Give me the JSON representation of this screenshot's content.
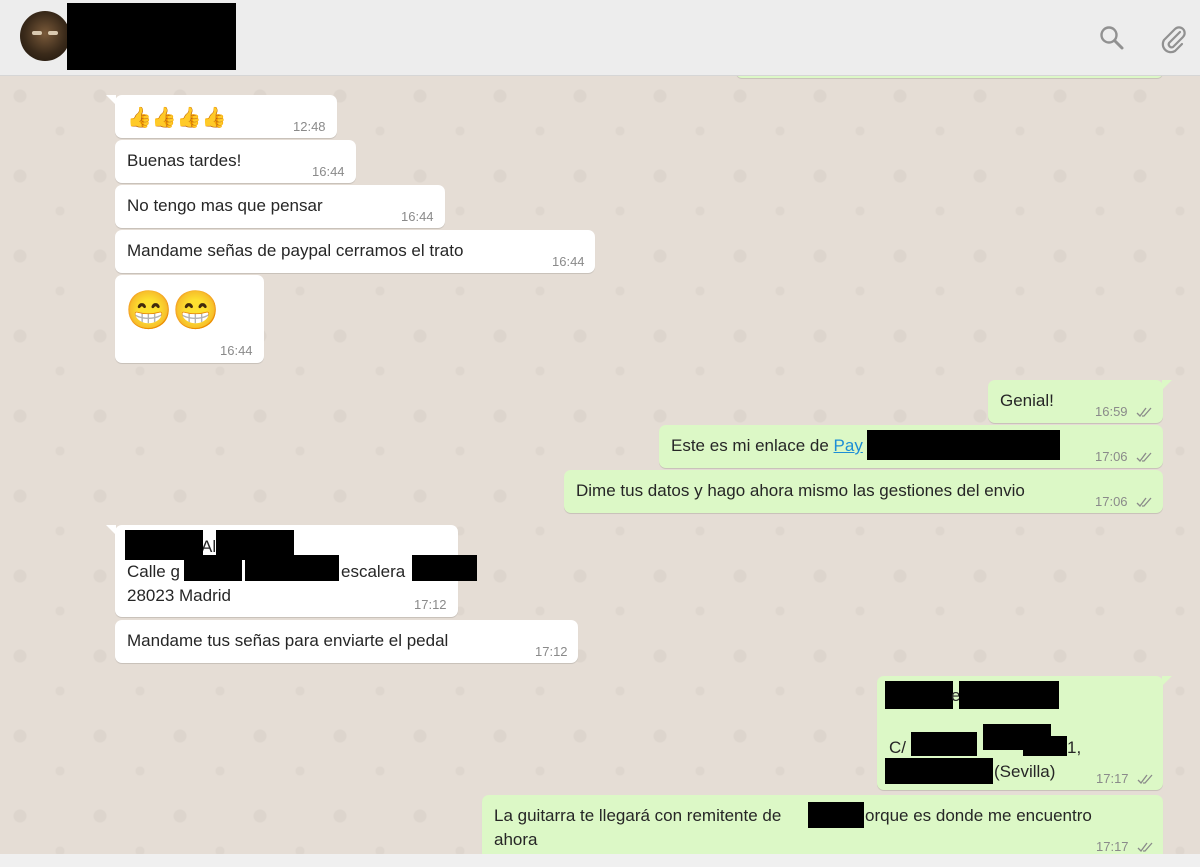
{
  "header": {
    "search_icon": "search-icon",
    "attach_icon": "paperclip-icon"
  },
  "messages": [
    {
      "id": "m1",
      "dir": "in",
      "text": "👍👍👍👍",
      "time": "12:48"
    },
    {
      "id": "m2",
      "dir": "in",
      "text": "Buenas tardes!",
      "time": "16:44"
    },
    {
      "id": "m3",
      "dir": "in",
      "text": "No tengo mas que pensar",
      "time": "16:44"
    },
    {
      "id": "m4",
      "dir": "in",
      "text": "Mandame señas de paypal cerramos el trato",
      "time": "16:44"
    },
    {
      "id": "m5",
      "dir": "in",
      "text": "😁😁",
      "time": "16:44"
    },
    {
      "id": "m6",
      "dir": "out",
      "text": "Genial!",
      "time": "16:59"
    },
    {
      "id": "m7",
      "dir": "out",
      "text_prefix": "Este es mi enlace de ",
      "link": "Pay",
      "time": "17:06"
    },
    {
      "id": "m8",
      "dir": "out",
      "text": "Dime tus datos y hago ahora mismo las gestiones del envio",
      "time": "17:06"
    },
    {
      "id": "m9",
      "dir": "in",
      "line1": "Al",
      "line2a": "Calle g",
      "line2b": "escalera",
      "line3": "28023 Madrid",
      "time": "17:12"
    },
    {
      "id": "m10",
      "dir": "in",
      "text": "Mandame tus señas para enviarte el pedal",
      "time": "17:12"
    },
    {
      "id": "m11",
      "dir": "out",
      "line1": "e",
      "line2a": "C/",
      "line2b": "1,",
      "line3": "(Sevilla)",
      "time": "17:17"
    },
    {
      "id": "m12",
      "dir": "out",
      "text_a": "La guitarra te llegará con remitente de ",
      "text_b": "orque es donde me encuentro",
      "text_c": "ahora",
      "time": "17:17"
    }
  ]
}
